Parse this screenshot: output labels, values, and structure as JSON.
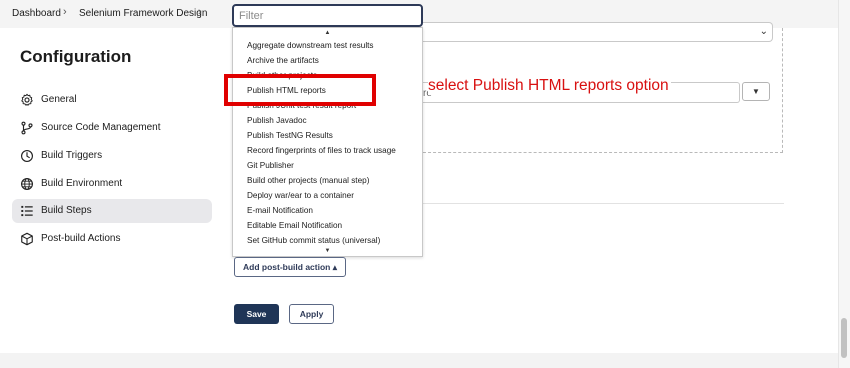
{
  "breadcrumb": {
    "items": [
      "Dashboard",
      "Selenium Framework Design"
    ],
    "separator": "›"
  },
  "sidebar": {
    "title": "Configuration",
    "items": [
      {
        "label": "General",
        "icon": "gear-icon"
      },
      {
        "label": "Source Code Management",
        "icon": "branch-icon"
      },
      {
        "label": "Build Triggers",
        "icon": "clock-icon"
      },
      {
        "label": "Build Environment",
        "icon": "globe-icon"
      },
      {
        "label": "Build Steps",
        "icon": "list-icon",
        "active": true
      },
      {
        "label": "Post-build Actions",
        "icon": "cube-icon"
      }
    ]
  },
  "filter": {
    "placeholder": "Filter",
    "value": ""
  },
  "dropdown": {
    "scroll_up": "▲",
    "scroll_down": "▼",
    "items": [
      "Aggregate downstream test results",
      "Archive the artifacts",
      "Build other projects",
      "Publish HTML reports",
      "Publish JUnit test result report",
      "Publish Javadoc",
      "Publish TestNG Results",
      "Record fingerprints of files to track usage",
      "Git Publisher",
      "Build other projects (manual step)",
      "Deploy war/ear to a container",
      "E-mail Notification",
      "Editable Email Notification",
      "Set GitHub commit status (universal)"
    ]
  },
  "annotation": {
    "text": "select Publish HTML reports option",
    "color": "#d81010"
  },
  "background_form": {
    "input_tail_text": "re",
    "small_button_label": "▼",
    "select_chevron": "⌄"
  },
  "actions": {
    "post_build_label": "Add post-build action ▴",
    "save_label": "Save",
    "apply_label": "Apply"
  },
  "colors": {
    "primary": "#1f3557",
    "accent_border": "#2e3a58",
    "annotation_red": "#e00000"
  }
}
